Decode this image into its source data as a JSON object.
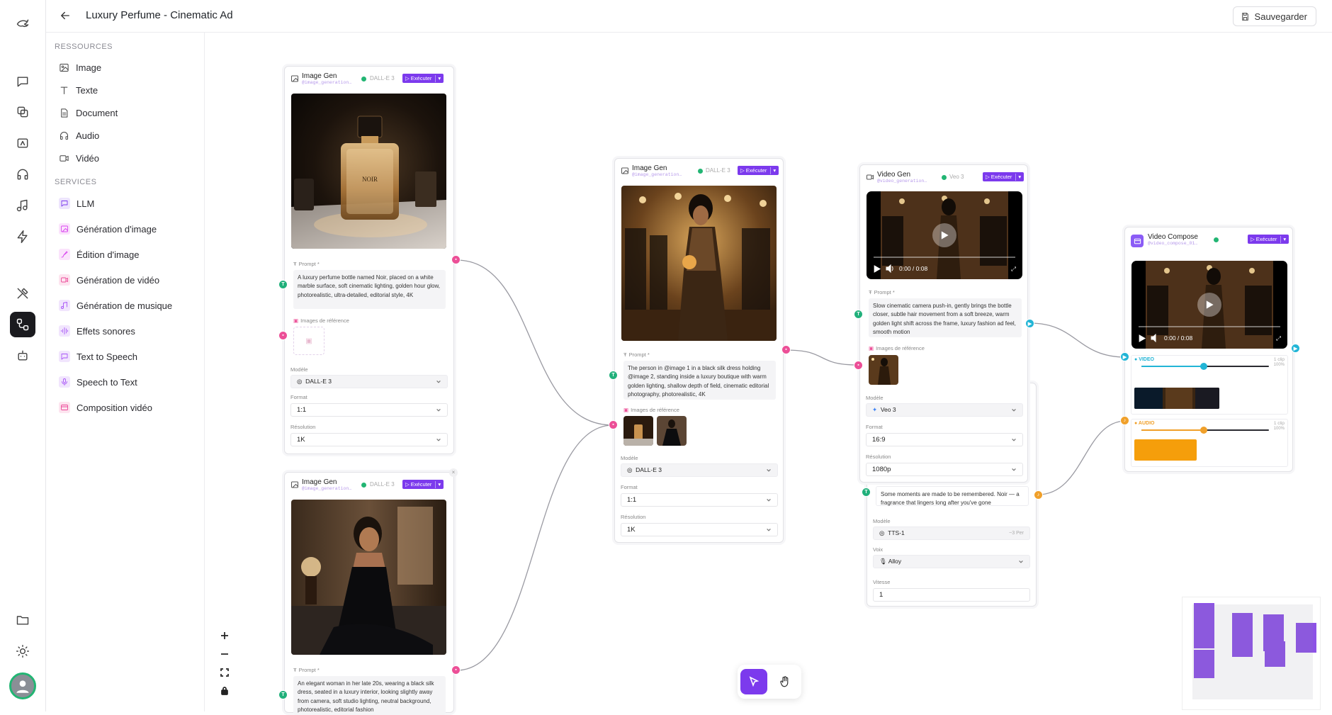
{
  "app": {
    "title": "Luxury Perfume - Cinematic Ad",
    "save_label": "Sauvegarder"
  },
  "sidebar": {
    "resources_title": "RESSOURCES",
    "resources": [
      {
        "label": "Image",
        "icon": "image-icon"
      },
      {
        "label": "Texte",
        "icon": "text-icon"
      },
      {
        "label": "Document",
        "icon": "document-icon"
      },
      {
        "label": "Audio",
        "icon": "audio-icon"
      },
      {
        "label": "Vidéo",
        "icon": "video-icon"
      }
    ],
    "services_title": "SERVICES",
    "services": [
      {
        "label": "LLM",
        "icon": "chat-icon",
        "color": "#7c3aed"
      },
      {
        "label": "Génération d'image",
        "icon": "image-gen-icon",
        "color": "#d946ef"
      },
      {
        "label": "Édition d'image",
        "icon": "brush-icon",
        "color": "#d946ef"
      },
      {
        "label": "Génération de vidéo",
        "icon": "video-gen-icon",
        "color": "#ec4899"
      },
      {
        "label": "Génération de musique",
        "icon": "music-icon",
        "color": "#a855f7"
      },
      {
        "label": "Effets sonores",
        "icon": "sfx-icon",
        "color": "#a855f7"
      },
      {
        "label": "Text to Speech",
        "icon": "tts-icon",
        "color": "#a855f7"
      },
      {
        "label": "Speech to Text",
        "icon": "mic-icon",
        "color": "#a855f7"
      },
      {
        "label": "Composition vidéo",
        "icon": "compose-icon",
        "color": "#ec4899"
      }
    ]
  },
  "nodes": {
    "img1": {
      "title": "Image Gen",
      "handle": "@image_generation…",
      "model_tag": "DALL-E 3",
      "run": "Exécuter",
      "prompt_label": "Prompt *",
      "prompt": "A luxury perfume bottle named Noir, placed on a white marble surface, soft cinematic lighting, golden hour glow, photorealistic, ultra-detailed, editorial style, 4K",
      "refs_label": "Images de référence",
      "model_label": "Modèle",
      "model": "DALL-E 3",
      "format_label": "Format",
      "format": "1:1",
      "res_label": "Résolution",
      "res": "1K",
      "bottle_text": "NOIR"
    },
    "img2": {
      "title": "Image Gen",
      "handle": "@image_generation…",
      "model_tag": "DALL-E 3",
      "run": "Exécuter",
      "prompt_label": "Prompt *",
      "prompt": "An elegant woman in her late 20s, wearing a black silk dress, seated in a luxury interior, looking slightly away from camera, soft studio lighting, neutral background, photorealistic, editorial fashion"
    },
    "img3": {
      "title": "Image Gen",
      "handle": "@image_generation…",
      "model_tag": "DALL-E 3",
      "run": "Exécuter",
      "prompt_label": "Prompt *",
      "prompt": "The person in @image 1 in a black silk dress holding @image 2, standing inside a luxury boutique with warm golden lighting, shallow depth of field, cinematic editorial photography, photorealistic, 4K",
      "refs_label": "Images de référence",
      "model_label": "Modèle",
      "model": "DALL-E 3",
      "format_label": "Format",
      "format": "1:1",
      "res_label": "Résolution",
      "res": "1K"
    },
    "vid": {
      "title": "Video Gen",
      "handle": "@video_generation…",
      "model_tag": "Veo 3",
      "run": "Exécuter",
      "time": "0:00 / 0:08",
      "prompt_label": "Prompt *",
      "prompt": "Slow cinematic camera push-in, gently brings the bottle closer, subtle hair movement from a soft breeze, warm golden light shift across the frame, luxury fashion ad feel, smooth motion",
      "refs_label": "Images de référence",
      "model_label": "Modèle",
      "model": "Veo 3",
      "format_label": "Format",
      "format": "16:9",
      "res_label": "Résolution",
      "res": "1080p"
    },
    "tts": {
      "text": "Some moments are made to be remembered. Noir — a fragrance that lingers long after you've gone",
      "model_label": "Modèle",
      "model": "TTS-1",
      "model_hint": "~3 Per",
      "voice_label": "Voix",
      "voice": "Alloy",
      "speed_label": "Vitesse",
      "speed": "1"
    },
    "compose": {
      "title": "Video Compose",
      "handle": "@video_compose_01…",
      "run": "Exécuter",
      "time": "0:00 / 0:08",
      "video_track": "VIDEO",
      "audio_track": "AUDIO",
      "clip_count": "1 clip",
      "clip_count2": "1 clip",
      "vol1": "100%",
      "vol2": "100%"
    }
  },
  "colors": {
    "accent": "#7c3aed",
    "ok": "#22b573",
    "pink": "#ec4f97",
    "cyan": "#22b5d6",
    "orange": "#f0a02a"
  }
}
